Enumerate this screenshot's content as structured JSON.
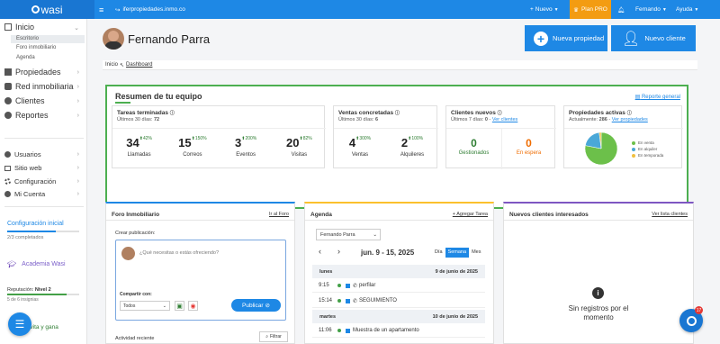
{
  "topbar": {
    "logo": "wasi",
    "url": "iferpropiedades.inmo.co",
    "nuevo": "Nuevo",
    "plan": "Plan PRO",
    "user": "Fernando",
    "ayuda": "Ayuda"
  },
  "sidebar": {
    "inicio": "Inicio",
    "sub": [
      "Escritorio",
      "Foro inmobiliario",
      "Agenda"
    ],
    "items": [
      "Propiedades",
      "Red inmobiliaria",
      "Clientes",
      "Reportes"
    ],
    "items2": [
      "Usuarios",
      "Sitio web",
      "Configuración",
      "Mi Cuenta"
    ],
    "config_title": "Configuración inicial",
    "config_progress": "2/3 completados",
    "config_fraction": 0.67,
    "academia": "Academia Wasi",
    "reputacion_label": "Reputación:",
    "reputacion_level": "Nivel 2",
    "insignias": "5 de 6 insignias",
    "invite": "Invita y gana"
  },
  "header": {
    "name": "Fernando Parra",
    "btn_propiedad": "Nueva propiedad",
    "btn_cliente": "Nuevo cliente",
    "breadcrumb_home": "Inicio",
    "breadcrumb_current": "Dashboard"
  },
  "summary": {
    "title": "Resumen de tu equipo",
    "report_link": "Reporte general",
    "tareas": {
      "title": "Tareas terminadas",
      "sub": "Últimos 30 días:",
      "total": "72",
      "stats": [
        {
          "value": "34",
          "pct": "42%",
          "label": "Llamadas"
        },
        {
          "value": "15",
          "pct": "150%",
          "label": "Correos"
        },
        {
          "value": "3",
          "pct": "200%",
          "label": "Eventos"
        },
        {
          "value": "20",
          "pct": "82%",
          "label": "Visitas"
        }
      ]
    },
    "ventas": {
      "title": "Ventas concretadas",
      "sub": "Últimos 30 días:",
      "total": "6",
      "stats": [
        {
          "value": "4",
          "pct": "300%",
          "label": "Ventas"
        },
        {
          "value": "2",
          "pct": "100%",
          "label": "Alquileres"
        }
      ]
    },
    "clientes": {
      "title": "Clientes nuevos",
      "sub": "Últimos 7 días:",
      "total": "0",
      "link": "Ver clientes",
      "gestionados_value": "0",
      "gestionados_label": "Gestionados",
      "espera_value": "0",
      "espera_label": "En espera"
    },
    "propiedades": {
      "title": "Propiedades activas",
      "sub": "Actualmente:",
      "total": "286",
      "link": "Ver propiedades",
      "legend": [
        "En venta",
        "En alquiler",
        "En temporada"
      ]
    }
  },
  "chart_data": {
    "type": "pie",
    "categories": [
      "En venta",
      "En alquiler",
      "En temporada"
    ],
    "values": [
      78,
      20,
      2
    ],
    "colors": [
      "#6cc04a",
      "#4aa8d8",
      "#f0c040"
    ]
  },
  "foro": {
    "title": "Foro Inmobiliario",
    "link": "Ir al Foro",
    "crear": "Crear publicación:",
    "placeholder": "¿Qué necesitas o estás ofreciendo?",
    "compartir": "Compartir con:",
    "select": "Todos",
    "publicar": "Publicar",
    "actividad": "Actividad reciente",
    "filtrar": "Filtrar"
  },
  "agenda": {
    "title": "Agenda",
    "link": "+ Agregar Tarea",
    "user": "Fernando Parra",
    "range": "jun. 9 - 15, 2025",
    "views": [
      "Día",
      "Semana",
      "Mes"
    ],
    "days": [
      {
        "day": "lunes",
        "date": "9 de junio de 2025"
      },
      {
        "day": "martes",
        "date": "10 de junio de 2025"
      }
    ],
    "events": [
      {
        "time": "9:15",
        "label": "perfilar"
      },
      {
        "time": "15:14",
        "label": "SEGUIMIENTO"
      },
      {
        "time": "11:06",
        "label": "Muestra de un apartamento"
      }
    ]
  },
  "interesados": {
    "title": "Nuevos clientes interesados",
    "link": "Ver lista clientes",
    "empty": "Sin registros por el momento"
  },
  "chat_badge": "17"
}
